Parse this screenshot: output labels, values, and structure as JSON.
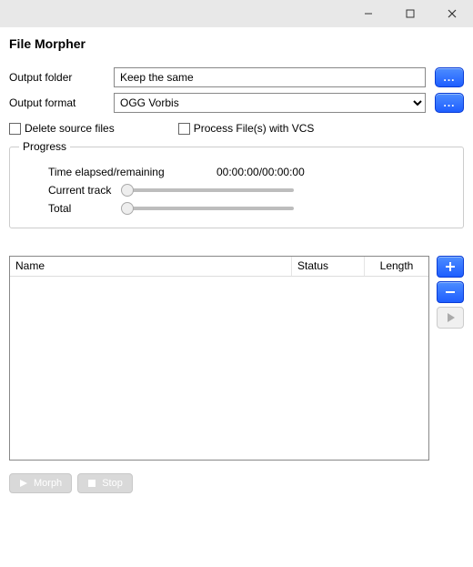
{
  "title": "File Morpher",
  "fields": {
    "output_folder_label": "Output folder",
    "output_folder_value": "Keep the same",
    "output_format_label": "Output format",
    "output_format_value": "OGG Vorbis",
    "browse_dots": "..."
  },
  "checks": {
    "delete_label": "Delete source files",
    "vcs_label": "Process File(s) with VCS"
  },
  "progress": {
    "legend": "Progress",
    "time_label": "Time elapsed/remaining",
    "time_value": "00:00:00/00:00:00",
    "current_label": "Current track",
    "total_label": "Total"
  },
  "table": {
    "col_name": "Name",
    "col_status": "Status",
    "col_length": "Length"
  },
  "buttons": {
    "morph": "Morph",
    "stop": "Stop"
  }
}
